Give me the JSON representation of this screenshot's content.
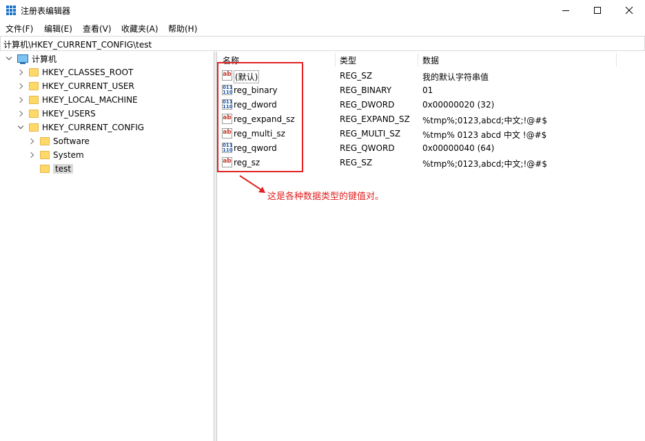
{
  "window": {
    "title": "注册表编辑器"
  },
  "menu": [
    "文件(F)",
    "编辑(E)",
    "查看(V)",
    "收藏夹(A)",
    "帮助(H)"
  ],
  "address": "计算机\\HKEY_CURRENT_CONFIG\\test",
  "tree": {
    "root": "计算机",
    "items": [
      {
        "label": "HKEY_CLASSES_ROOT",
        "expanded": false
      },
      {
        "label": "HKEY_CURRENT_USER",
        "expanded": false
      },
      {
        "label": "HKEY_LOCAL_MACHINE",
        "expanded": false
      },
      {
        "label": "HKEY_USERS",
        "expanded": false
      },
      {
        "label": "HKEY_CURRENT_CONFIG",
        "expanded": true
      }
    ],
    "children": [
      {
        "label": "Software",
        "expanded": false
      },
      {
        "label": "System",
        "expanded": false
      },
      {
        "label": "test",
        "selected": true
      }
    ]
  },
  "columns": [
    "名称",
    "类型",
    "数据"
  ],
  "values": [
    {
      "name": "(默认)",
      "type": "REG_SZ",
      "data": "我的默认字符串值",
      "icon": "string-value-icon"
    },
    {
      "name": "reg_binary",
      "type": "REG_BINARY",
      "data": "01",
      "icon": "binary-value-icon"
    },
    {
      "name": "reg_dword",
      "type": "REG_DWORD",
      "data": "0x00000020 (32)",
      "icon": "binary-value-icon"
    },
    {
      "name": "reg_expand_sz",
      "type": "REG_EXPAND_SZ",
      "data": "%tmp%;0123,abcd;中文;!@#$",
      "icon": "string-value-icon"
    },
    {
      "name": "reg_multi_sz",
      "type": "REG_MULTI_SZ",
      "data": "%tmp% 0123 abcd 中文 !@#$",
      "icon": "string-value-icon"
    },
    {
      "name": "reg_qword",
      "type": "REG_QWORD",
      "data": "0x00000040 (64)",
      "icon": "binary-value-icon"
    },
    {
      "name": "reg_sz",
      "type": "REG_SZ",
      "data": "%tmp%;0123,abcd;中文;!@#$",
      "icon": "string-value-icon"
    }
  ],
  "annotation": {
    "text": "这是各种数据类型的键值对。",
    "color": "#e02020"
  }
}
